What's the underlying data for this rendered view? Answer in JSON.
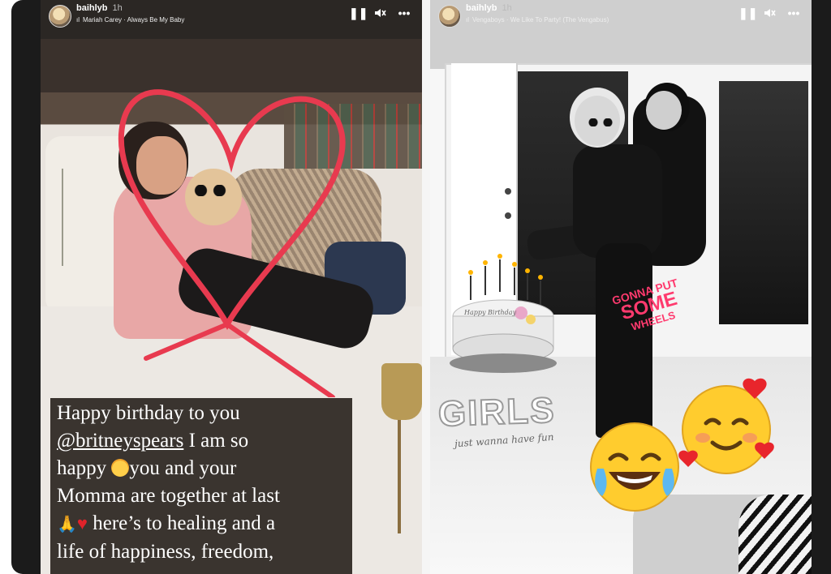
{
  "stories": [
    {
      "username": "baihlyb",
      "time": "1h",
      "music": "Mariah Carey · Always Be My Baby",
      "caption": {
        "line1": "Happy birthday to you",
        "mention": "@britneyspears",
        "line2_rest": " I am so",
        "line3_a": "happy ",
        "line3_b": "you and your",
        "line4": "Momma are together at last",
        "line5": " here’s to healing and a",
        "line6": "life of happiness, freedom,"
      }
    },
    {
      "username": "baihlyb",
      "time": "1h",
      "music": "Vengaboys · We Like To Party! (The Vengabus)",
      "stickers": {
        "gonna": [
          "GONNA PUT",
          "SOME",
          "WHEELS"
        ],
        "girls_title": "GIRLS",
        "girls_sub": "just wanna have fun",
        "cake_text": "Happy Birthday"
      }
    }
  ],
  "icons": {
    "pause": "pause-icon",
    "mute": "mute-icon",
    "more": "more-icon",
    "music": "music-note-icon"
  },
  "colors": {
    "heart_outline": "#e83a4f",
    "sticker_pink": "#ff3a6e",
    "caption_bg": "#3a342f"
  }
}
